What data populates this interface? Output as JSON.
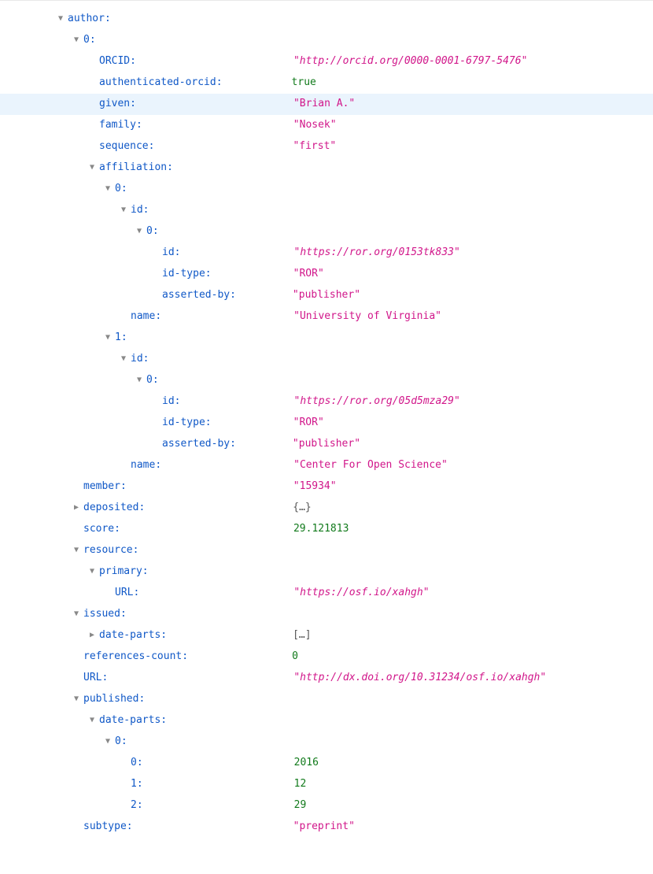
{
  "indentUnit": 20,
  "baseIndent": 70,
  "valueColumn": 370,
  "rows": [
    {
      "depth": 0,
      "toggle": "down",
      "key": "author",
      "vtype": null
    },
    {
      "depth": 1,
      "toggle": "down",
      "key": "0",
      "vtype": null
    },
    {
      "depth": 2,
      "toggle": "none",
      "key": "ORCID",
      "vtype": "link",
      "value": "http://orcid.org/0000-0001-6797-5476"
    },
    {
      "depth": 2,
      "toggle": "none",
      "key": "authenticated-orcid",
      "vtype": "bool",
      "value": "true"
    },
    {
      "depth": 2,
      "toggle": "none",
      "key": "given",
      "vtype": "string",
      "value": "Brian A.",
      "highlight": true
    },
    {
      "depth": 2,
      "toggle": "none",
      "key": "family",
      "vtype": "string",
      "value": "Nosek"
    },
    {
      "depth": 2,
      "toggle": "none",
      "key": "sequence",
      "vtype": "string",
      "value": "first"
    },
    {
      "depth": 2,
      "toggle": "down",
      "key": "affiliation",
      "vtype": null
    },
    {
      "depth": 3,
      "toggle": "down",
      "key": "0",
      "vtype": null
    },
    {
      "depth": 4,
      "toggle": "down",
      "key": "id",
      "vtype": null
    },
    {
      "depth": 5,
      "toggle": "down",
      "key": "0",
      "vtype": null
    },
    {
      "depth": 6,
      "toggle": "none",
      "key": "id",
      "vtype": "link",
      "value": "https://ror.org/0153tk833"
    },
    {
      "depth": 6,
      "toggle": "none",
      "key": "id-type",
      "vtype": "string",
      "value": "ROR"
    },
    {
      "depth": 6,
      "toggle": "none",
      "key": "asserted-by",
      "vtype": "string",
      "value": "publisher"
    },
    {
      "depth": 4,
      "toggle": "none",
      "key": "name",
      "vtype": "string",
      "value": "University of Virginia"
    },
    {
      "depth": 3,
      "toggle": "down",
      "key": "1",
      "vtype": null
    },
    {
      "depth": 4,
      "toggle": "down",
      "key": "id",
      "vtype": null
    },
    {
      "depth": 5,
      "toggle": "down",
      "key": "0",
      "vtype": null
    },
    {
      "depth": 6,
      "toggle": "none",
      "key": "id",
      "vtype": "link",
      "value": "https://ror.org/05d5mza29"
    },
    {
      "depth": 6,
      "toggle": "none",
      "key": "id-type",
      "vtype": "string",
      "value": "ROR"
    },
    {
      "depth": 6,
      "toggle": "none",
      "key": "asserted-by",
      "vtype": "string",
      "value": "publisher"
    },
    {
      "depth": 4,
      "toggle": "none",
      "key": "name",
      "vtype": "string",
      "value": "Center For Open Science"
    },
    {
      "depth": 1,
      "toggle": "none",
      "key": "member",
      "vtype": "string",
      "value": "15934"
    },
    {
      "depth": 1,
      "toggle": "right",
      "key": "deposited",
      "vtype": "coll",
      "value": "{…}"
    },
    {
      "depth": 1,
      "toggle": "none",
      "key": "score",
      "vtype": "number",
      "value": "29.121813"
    },
    {
      "depth": 1,
      "toggle": "down",
      "key": "resource",
      "vtype": null
    },
    {
      "depth": 2,
      "toggle": "down",
      "key": "primary",
      "vtype": null
    },
    {
      "depth": 3,
      "toggle": "none",
      "key": "URL",
      "vtype": "link",
      "value": "https://osf.io/xahgh"
    },
    {
      "depth": 1,
      "toggle": "down",
      "key": "issued",
      "vtype": null
    },
    {
      "depth": 2,
      "toggle": "right",
      "key": "date-parts",
      "vtype": "coll",
      "value": "[…]"
    },
    {
      "depth": 1,
      "toggle": "none",
      "key": "references-count",
      "vtype": "number",
      "value": "0"
    },
    {
      "depth": 1,
      "toggle": "none",
      "key": "URL",
      "vtype": "link",
      "value": "http://dx.doi.org/10.31234/osf.io/xahgh"
    },
    {
      "depth": 1,
      "toggle": "down",
      "key": "published",
      "vtype": null
    },
    {
      "depth": 2,
      "toggle": "down",
      "key": "date-parts",
      "vtype": null
    },
    {
      "depth": 3,
      "toggle": "down",
      "key": "0",
      "vtype": null
    },
    {
      "depth": 4,
      "toggle": "none",
      "key": "0",
      "vtype": "number",
      "value": "2016"
    },
    {
      "depth": 4,
      "toggle": "none",
      "key": "1",
      "vtype": "number",
      "value": "12"
    },
    {
      "depth": 4,
      "toggle": "none",
      "key": "2",
      "vtype": "number",
      "value": "29"
    },
    {
      "depth": 1,
      "toggle": "none",
      "key": "subtype",
      "vtype": "string",
      "value": "preprint"
    }
  ],
  "glyphs": {
    "down": "▼",
    "right": "▶",
    "none": "▶"
  }
}
